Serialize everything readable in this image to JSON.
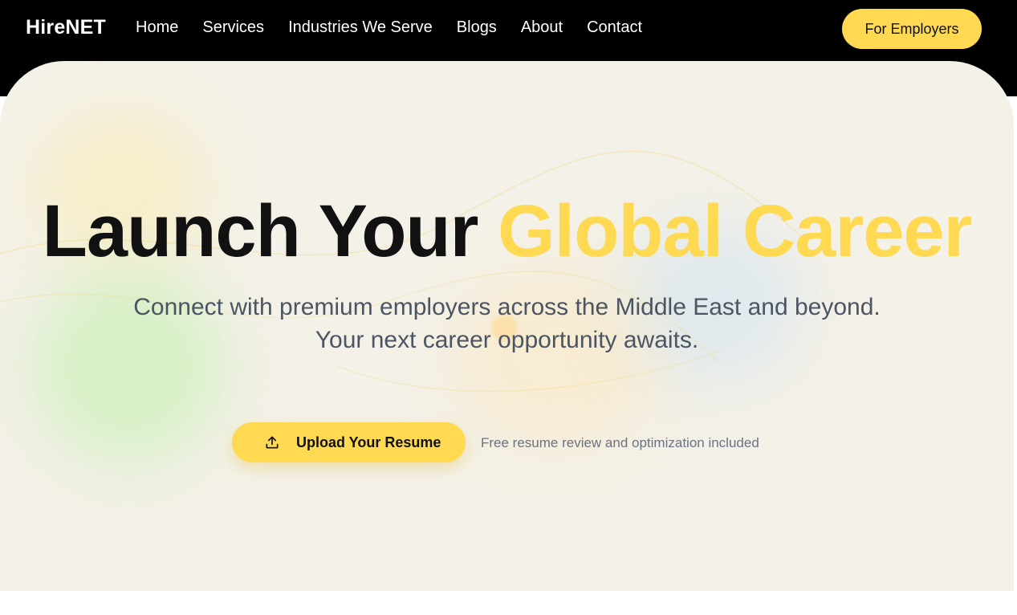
{
  "header": {
    "logo": "HireNET",
    "nav": [
      {
        "label": "Home"
      },
      {
        "label": "Services"
      },
      {
        "label": "Industries We Serve"
      },
      {
        "label": "Blogs"
      },
      {
        "label": "About"
      },
      {
        "label": "Contact"
      }
    ],
    "cta_label": "For Employers"
  },
  "hero": {
    "headline_part1": "Launch Your",
    "headline_accent": "Global Career",
    "subtitle_line1": "Connect with premium employers across the Middle East and beyond.",
    "subtitle_line2": "Your next career opportunity awaits.",
    "upload_label": "Upload Your Resume",
    "upload_icon": "upload-icon",
    "note": "Free resume review and optimization included"
  },
  "colors": {
    "accent": "#FFD952",
    "header_bg": "#000000",
    "hero_bg": "#f4f1e8",
    "heading_text": "#111111",
    "subtitle_text": "#4b5563",
    "note_text": "#6b7280"
  }
}
